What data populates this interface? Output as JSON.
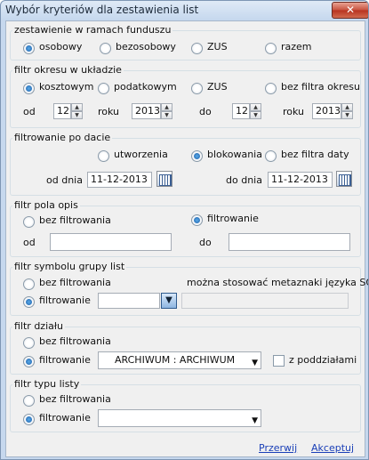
{
  "window": {
    "title": "Wybór kryteriów dla zestawienia list",
    "close_glyph": "✕"
  },
  "group1": {
    "legend": "zestawienie w ramach funduszu",
    "options": [
      "osobowy",
      "bezosobowy",
      "ZUS",
      "razem"
    ],
    "selected": "osobowy"
  },
  "group2": {
    "legend": "filtr okresu w układzie",
    "options": [
      "kosztowym",
      "podatkowym",
      "ZUS",
      "bez filtra okresu"
    ],
    "selected": "kosztowym",
    "from_label": "od",
    "year_label": "roku",
    "to_label": "do",
    "from_month": "12",
    "from_year": "2013",
    "to_month": "12",
    "to_year": "2013"
  },
  "group3": {
    "legend": "filtrowanie po dacie",
    "options": [
      "utworzenia",
      "blokowania",
      "bez filtra daty"
    ],
    "selected": "blokowania",
    "from_label": "od dnia",
    "to_label": "do dnia",
    "from_date": "11-12-2013",
    "to_date": "11-12-2013"
  },
  "group4": {
    "legend": "filtr pola opis",
    "options": [
      "bez filtrowania",
      "filtrowanie"
    ],
    "selected": "filtrowanie",
    "from_label": "od",
    "to_label": "do",
    "from_value": "",
    "to_value": ""
  },
  "group5": {
    "legend": "filtr symbolu grupy list",
    "options": [
      "bez filtrowania",
      "filtrowanie"
    ],
    "selected": "filtrowanie",
    "hint": "można stosować metaznaki języka SQL",
    "select_value": "",
    "pattern_value": ""
  },
  "group6": {
    "legend": "filtr działu",
    "options": [
      "bez filtrowania",
      "filtrowanie"
    ],
    "selected": "filtrowanie",
    "select_value": "ARCHIWUM : ARCHIWUM",
    "subdivisions_label": "z poddziałami",
    "subdivisions_checked": false
  },
  "group7": {
    "legend": "filtr typu listy",
    "options": [
      "bez filtrowania",
      "filtrowanie"
    ],
    "selected": "filtrowanie",
    "select_value": ""
  },
  "footer": {
    "cancel": "Przerwij",
    "accept": "Akceptuj"
  }
}
